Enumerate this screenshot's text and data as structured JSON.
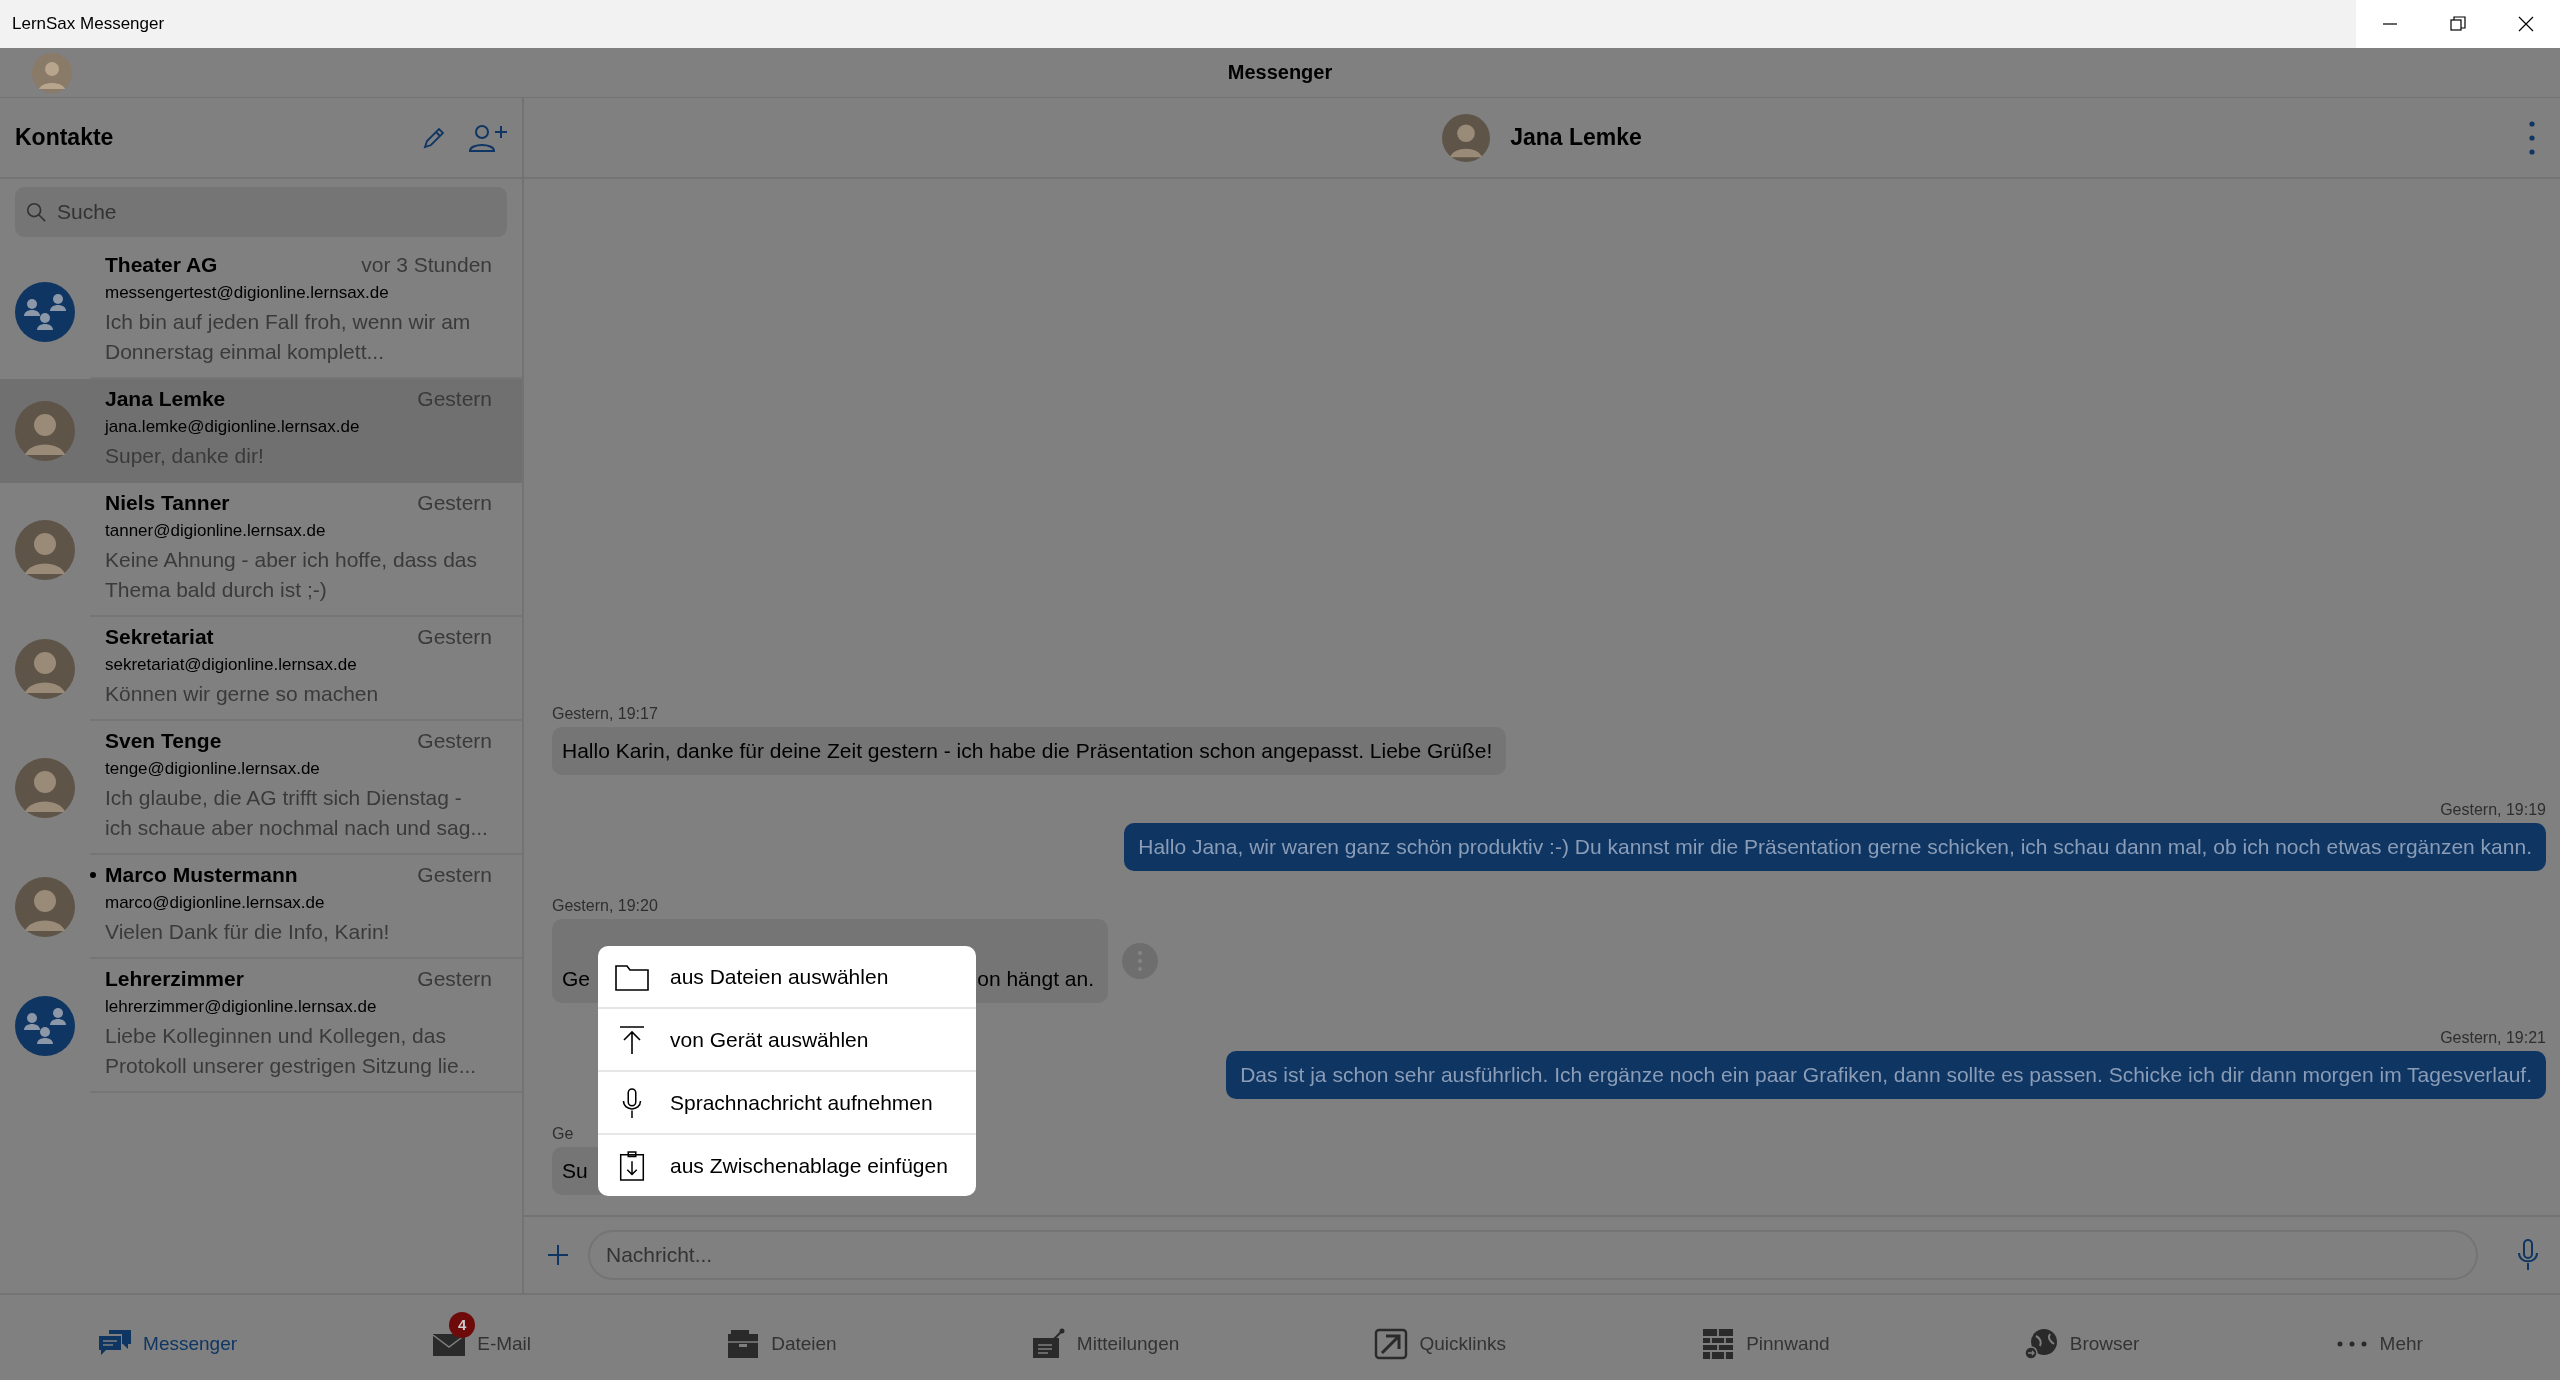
{
  "window": {
    "title": "LernSax Messenger"
  },
  "app_bar": {
    "title": "Messenger"
  },
  "contacts": {
    "title": "Kontakte",
    "search": {
      "placeholder": "Suche"
    },
    "items": [
      {
        "name": "Theater AG",
        "time": "vor 3 Stunden",
        "email": "messengertest@digionline.lernsax.de",
        "preview": "Ich bin auf jeden Fall froh, wenn wir am Donnerstag einmal komplett...",
        "kind": "group",
        "selected": false,
        "unread": false
      },
      {
        "name": "Jana Lemke",
        "time": "Gestern",
        "email": "jana.lemke@digionline.lernsax.de",
        "preview": "Super, danke dir!",
        "kind": "person",
        "selected": true,
        "unread": false
      },
      {
        "name": "Niels Tanner",
        "time": "Gestern",
        "email": "tanner@digionline.lernsax.de",
        "preview": "Keine Ahnung - aber ich hoffe, dass das Thema bald durch ist ;-)",
        "kind": "person",
        "selected": false,
        "unread": false
      },
      {
        "name": "Sekretariat",
        "time": "Gestern",
        "email": "sekretariat@digionline.lernsax.de",
        "preview": "Können wir gerne so machen",
        "kind": "person",
        "selected": false,
        "unread": false
      },
      {
        "name": "Sven Tenge",
        "time": "Gestern",
        "email": "tenge@digionline.lernsax.de",
        "preview": "Ich glaube, die AG trifft sich Dienstag - ich schaue aber nochmal nach und sag...",
        "kind": "person",
        "selected": false,
        "unread": false
      },
      {
        "name": "Marco Mustermann",
        "time": "Gestern",
        "email": "marco@digionline.lernsax.de",
        "preview": "Vielen Dank für die Info, Karin!",
        "kind": "person",
        "selected": false,
        "unread": true
      },
      {
        "name": "Lehrerzimmer",
        "time": "Gestern",
        "email": "lehrerzimmer@digionline.lernsax.de",
        "preview": "Liebe Kolleginnen und Kollegen, das Protokoll unserer gestrigen Sitzung lie...",
        "kind": "group",
        "selected": false,
        "unread": false
      }
    ]
  },
  "chat": {
    "contact": "Jana Lemke",
    "messages": [
      {
        "kind": "received",
        "time": "Gestern, 19:17",
        "text": "Hallo Karin, danke für deine Zeit gestern - ich habe die Präsentation schon angepasst. Liebe Grüße!"
      },
      {
        "kind": "sent",
        "time": "Gestern, 19:19",
        "text": "Hallo Jana, wir waren ganz schön produktiv :-) Du kannst mir die Präsentation gerne schicken, ich schau dann mal, ob ich noch etwas ergänzen kann."
      },
      {
        "kind": "received",
        "time": "Gestern, 19:20",
        "text": "Ge",
        "text_after_menu": "on hängt an.",
        "has_actions": true
      },
      {
        "kind": "sent",
        "time": "Gestern, 19:21",
        "text": "Das ist ja schon sehr ausführlich. Ich ergänze noch ein paar Grafiken, dann sollte es passen. Schicke ich dir dann morgen im Tagesverlauf."
      },
      {
        "kind": "received",
        "time": "Ge",
        "text": "Su"
      }
    ],
    "input": {
      "placeholder": "Nachricht..."
    },
    "attach_menu": [
      {
        "kind": "folder",
        "label": "aus Dateien auswählen"
      },
      {
        "kind": "upload",
        "label": "von Gerät auswählen"
      },
      {
        "kind": "mic",
        "label": "Sprachnachricht aufnehmen"
      },
      {
        "kind": "clipboard",
        "label": "aus Zwischenablage einfügen"
      }
    ]
  },
  "nav": [
    {
      "kind": "messenger",
      "label": "Messenger",
      "selected": true
    },
    {
      "kind": "mail",
      "label": "E-Mail",
      "selected": false,
      "badge": "4"
    },
    {
      "kind": "files",
      "label": "Dateien",
      "selected": false
    },
    {
      "kind": "notices",
      "label": "Mitteilungen",
      "selected": false
    },
    {
      "kind": "links",
      "label": "Quicklinks",
      "selected": false
    },
    {
      "kind": "board",
      "label": "Pinnwand",
      "selected": false
    },
    {
      "kind": "browser",
      "label": "Browser",
      "selected": false
    },
    {
      "kind": "more",
      "label": "Mehr",
      "selected": false
    }
  ]
}
